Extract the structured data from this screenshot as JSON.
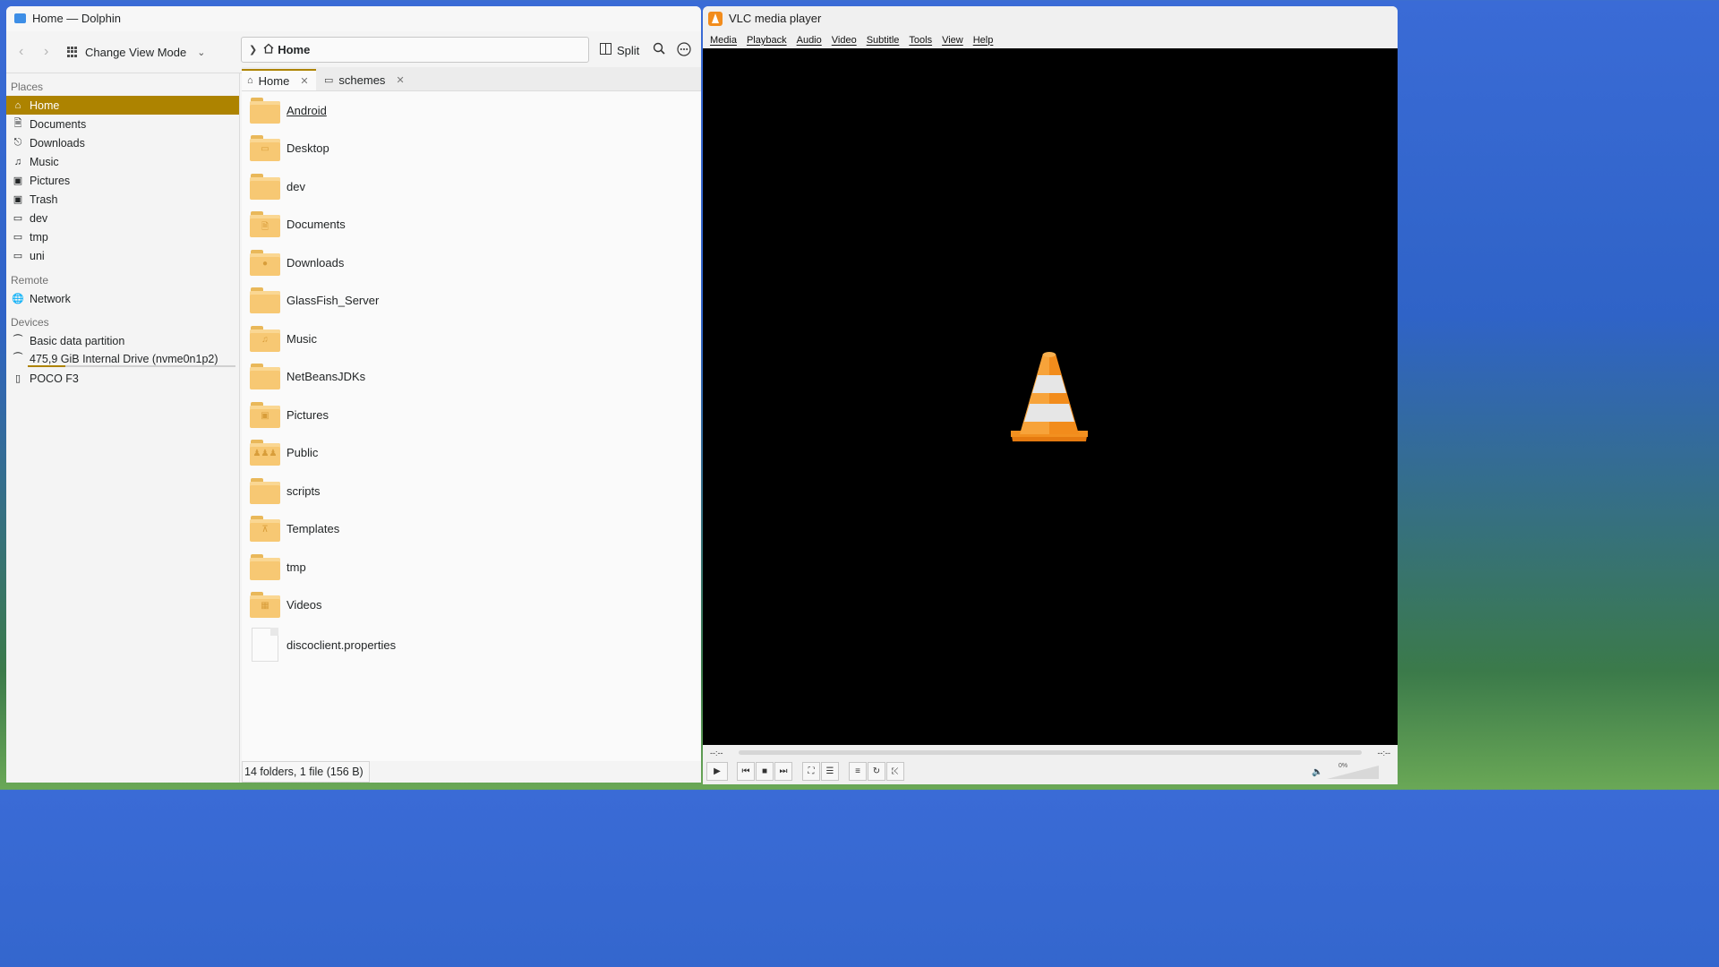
{
  "dolphin": {
    "title": "Home — Dolphin",
    "toolbar": {
      "view_mode_label": "Change View Mode",
      "location": "Home",
      "split_label": "Split"
    },
    "places_heading": "Places",
    "places": [
      "Home",
      "Documents",
      "Downloads",
      "Music",
      "Pictures",
      "Trash",
      "dev",
      "tmp",
      "uni"
    ],
    "remote_heading": "Remote",
    "remote": [
      "Network"
    ],
    "devices_heading": "Devices",
    "devices": [
      "Basic data partition",
      "475,9 GiB Internal Drive (nvme0n1p2)",
      "POCO F3"
    ],
    "drive_usage_fraction": 0.18,
    "tabs": [
      "Home",
      "schemes"
    ],
    "active_tab": "Home",
    "files": [
      "Android",
      "Desktop",
      "dev",
      "Documents",
      "Downloads",
      "GlassFish_Server",
      "Music",
      "NetBeansJDKs",
      "Pictures",
      "Public",
      "scripts",
      "Templates",
      "tmp",
      "Videos",
      "discoclient.properties"
    ],
    "status": "14 folders, 1 file (156 B)",
    "accent_color": "#ad8300"
  },
  "vlc": {
    "title": "VLC media player",
    "menu": [
      "Media",
      "Playback",
      "Audio",
      "Video",
      "Subtitle",
      "Tools",
      "View",
      "Help"
    ],
    "time_elapsed": "--:--",
    "time_total": "--:--",
    "volume": "0%",
    "cone_color": "#f28c1c"
  }
}
